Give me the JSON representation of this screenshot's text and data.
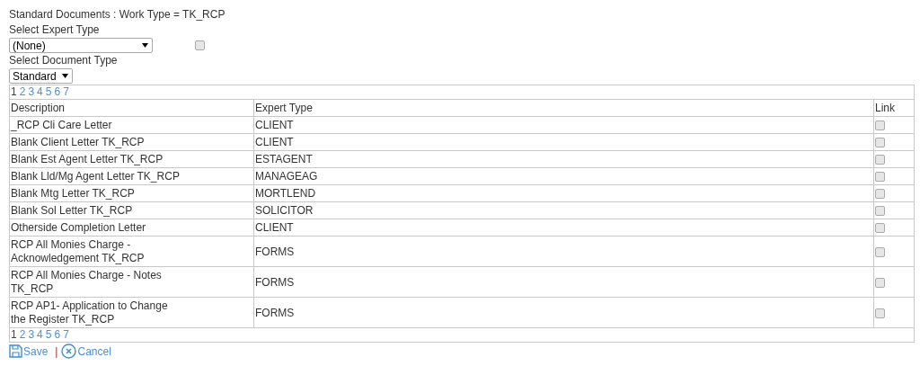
{
  "heading": "Standard Documents : Work Type = TK_RCP",
  "expert_type": {
    "label": "Select Expert Type",
    "value": "(None)",
    "checked": false
  },
  "document_type": {
    "label": "Select Document Type",
    "value": "Standard"
  },
  "pager_top": [
    {
      "label": "1",
      "selected": true
    },
    {
      "label": "2",
      "selected": false
    },
    {
      "label": "3",
      "selected": false
    },
    {
      "label": "4",
      "selected": false
    },
    {
      "label": "5",
      "selected": false
    },
    {
      "label": "6",
      "selected": false
    },
    {
      "label": "7",
      "selected": false
    }
  ],
  "table": {
    "columns": [
      "Description",
      "Expert Type",
      "Link"
    ],
    "rows": [
      {
        "description": "_RCP Cli Care Letter",
        "expert_type": "CLIENT",
        "link": false
      },
      {
        "description": "Blank Client Letter TK_RCP",
        "expert_type": "CLIENT",
        "link": false
      },
      {
        "description": "Blank Est Agent Letter TK_RCP",
        "expert_type": "ESTAGENT",
        "link": false
      },
      {
        "description": "Blank Lld/Mg Agent Letter TK_RCP",
        "expert_type": "MANAGEAG",
        "link": false
      },
      {
        "description": "Blank Mtg Letter TK_RCP",
        "expert_type": "MORTLEND",
        "link": false
      },
      {
        "description": "Blank Sol Letter TK_RCP",
        "expert_type": "SOLICITOR",
        "link": false
      },
      {
        "description": "Otherside Completion Letter",
        "expert_type": "CLIENT",
        "link": false
      },
      {
        "description": "RCP All Monies Charge -\nAcknowledgement TK_RCP",
        "expert_type": "FORMS",
        "link": false
      },
      {
        "description": "RCP All Monies Charge - Notes\nTK_RCP",
        "expert_type": "FORMS",
        "link": false
      },
      {
        "description": "RCP AP1- Application to Change\nthe Register TK_RCP",
        "expert_type": "FORMS",
        "link": false
      }
    ]
  },
  "pager_bottom": [
    {
      "label": "1",
      "selected": true
    },
    {
      "label": "2",
      "selected": false
    },
    {
      "label": "3",
      "selected": false
    },
    {
      "label": "4",
      "selected": false
    },
    {
      "label": "5",
      "selected": false
    },
    {
      "label": "6",
      "selected": false
    },
    {
      "label": "7",
      "selected": false
    }
  ],
  "actions": [
    {
      "kind": "save",
      "label": "Save"
    },
    {
      "kind": "separator",
      "label": "|"
    },
    {
      "kind": "cancel",
      "label": "Cancel"
    }
  ]
}
